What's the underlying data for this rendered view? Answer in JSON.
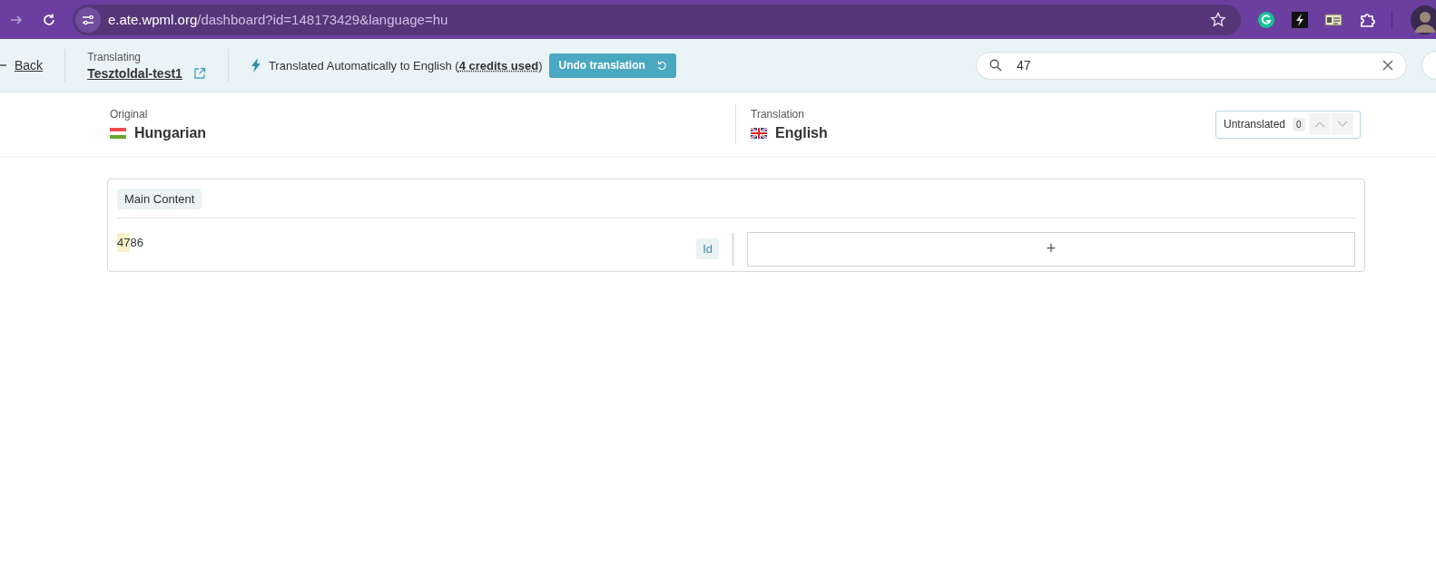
{
  "browser": {
    "url_host": "e.ate.wpml.org",
    "url_path": "/dashboard?id=148173429&language=hu"
  },
  "toolbar": {
    "back": "Back",
    "translating_label": "Translating",
    "document": "Tesztoldal-test1",
    "status": "Translated Automatically to English (**4 credits used**)",
    "undo": "Undo translation",
    "search": {
      "value": "47"
    }
  },
  "languages": {
    "original_label": "Original",
    "original": "Hungarian",
    "translation_label": "Translation",
    "translation": "English",
    "untranslated_label": "Untranslated",
    "untranslated_count": "0"
  },
  "section": {
    "title": "Main Content",
    "rows": [
      {
        "source": [
          {
            "text": "47",
            "highlighted": true
          },
          {
            "text": "86",
            "highlighted": false
          }
        ],
        "tag": "Id",
        "translation": "+"
      }
    ]
  }
}
